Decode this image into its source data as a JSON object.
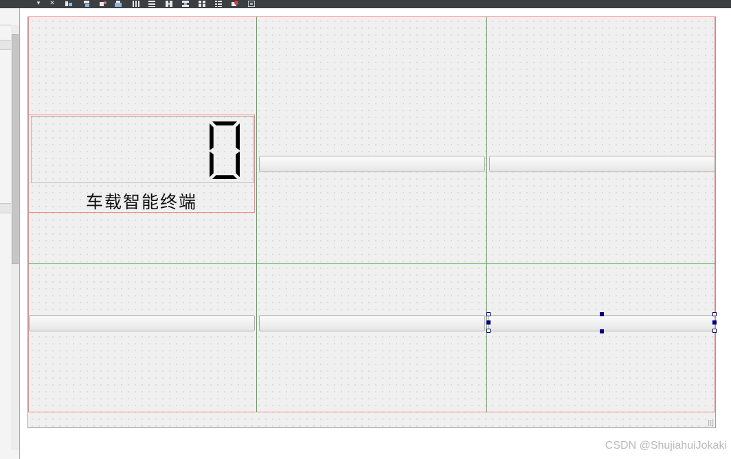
{
  "toolbar": {
    "icons": [
      "dropdown-icon",
      "close-icon",
      "layout-horizontal-icon",
      "layout-vertical-icon",
      "edit-signals-icon",
      "edit-buddies-icon",
      "lay-out-horizontally-icon",
      "lay-out-vertically-icon",
      "lay-out-horizontal-splitter-icon",
      "lay-out-vertical-splitter-icon",
      "lay-out-grid-icon",
      "lay-out-form-icon",
      "break-layout-icon",
      "adjust-size-icon"
    ],
    "dropdown_glyph": "▾",
    "close_glyph": "✕"
  },
  "form": {
    "lcd_value": "0",
    "title_label": "车载智能终端",
    "push_buttons": [
      {
        "text": ""
      },
      {
        "text": ""
      },
      {
        "text": ""
      },
      {
        "text": ""
      },
      {
        "text": "",
        "selected": true
      }
    ]
  },
  "colors": {
    "layout_border": "#ff8080",
    "grid_line": "#4cae4c",
    "selection_handle": "#000080",
    "canvas_background": "#f0f0f0",
    "toolbar_background": "#3c3f41"
  },
  "watermark": "CSDN @ShujiahuiJokaki"
}
